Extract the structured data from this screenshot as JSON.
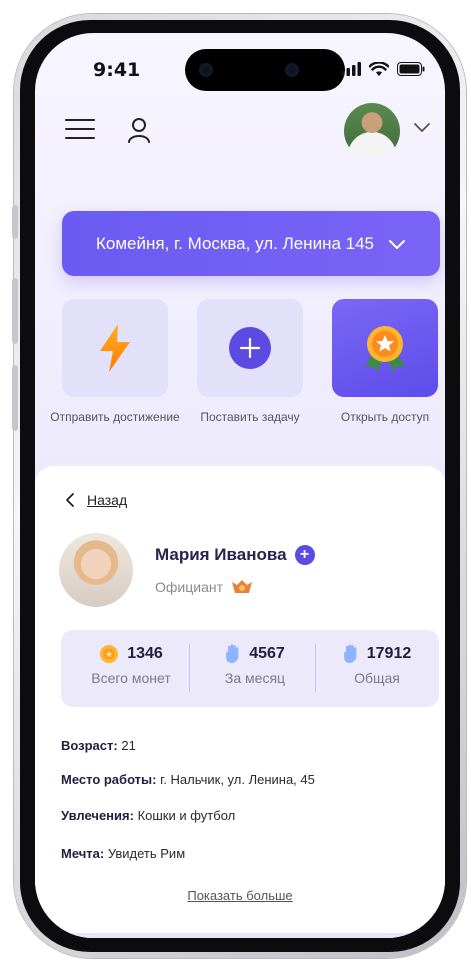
{
  "status_bar": {
    "time": "9:41"
  },
  "location": {
    "label": "Комейня, г. Москва, ул. Ленина 145"
  },
  "actions": [
    {
      "label": "Отправить достижение",
      "icon": "lightning-icon"
    },
    {
      "label": "Поставить задачу",
      "icon": "plus-icon"
    },
    {
      "label": "Открыть доступ",
      "icon": "medal-icon"
    }
  ],
  "profile": {
    "back_label": "Назад",
    "name": "Мария Иванова",
    "role": "Официант"
  },
  "stats": [
    {
      "value": "1346",
      "label": "Всего монет",
      "icon": "coin-icon"
    },
    {
      "value": "4567",
      "label": "За месяц",
      "icon": "hand-icon"
    },
    {
      "value": "17912",
      "label": "Общая",
      "icon": "hand-icon"
    }
  ],
  "info": {
    "age_label": "Возраст:",
    "age_value": "21",
    "work_label": "Место работы:",
    "work_value": "г. Нальчик, ул. Ленина, 45",
    "hobby_label": "Увлечения:",
    "hobby_value": "Кошки и футбол",
    "dream_label": "Мечта:",
    "dream_value": "Увидеть Рим"
  },
  "show_more": "Показать больше",
  "colors": {
    "accent": "#6b5bf2",
    "accent_dark": "#5b4be3",
    "card_bg": "#ece9fb",
    "text_dark": "#231d40"
  }
}
